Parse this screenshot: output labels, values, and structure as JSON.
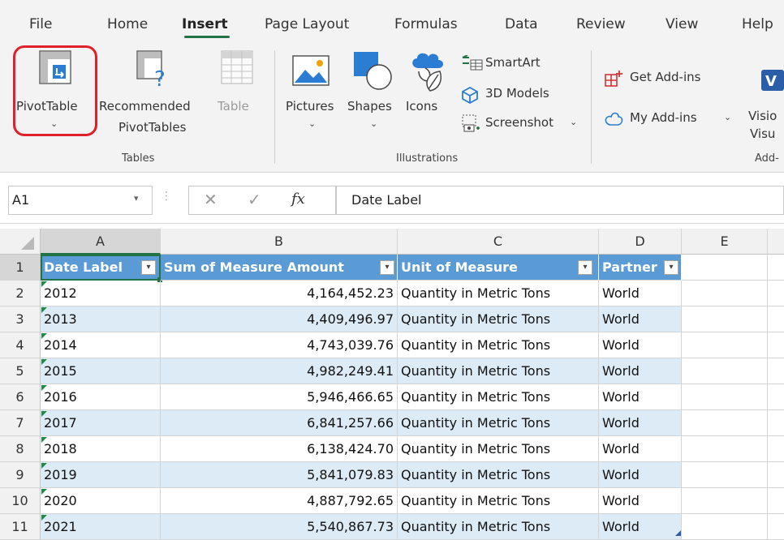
{
  "ribbon": {
    "tabs": [
      "File",
      "Home",
      "Insert",
      "Page Layout",
      "Formulas",
      "Data",
      "Review",
      "View",
      "Help"
    ],
    "active_tab": "Insert",
    "tables_group": {
      "label": "Tables",
      "pivottable": "PivotTable",
      "recommended_line1": "Recommended",
      "recommended_line2": "PivotTables",
      "table": "Table"
    },
    "illustrations_group": {
      "label": "Illustrations",
      "pictures": "Pictures",
      "shapes": "Shapes",
      "icons": "Icons",
      "smartart": "SmartArt",
      "models3d": "3D Models",
      "screenshot": "Screenshot"
    },
    "addins_group": {
      "label": "Add-",
      "get_addins": "Get Add-ins",
      "my_addins": "My Add-ins",
      "visio_line1": "Visio",
      "visio_line2": "Visu"
    },
    "colors": {
      "accent": "#217346",
      "highlight": "#e0202a"
    }
  },
  "formula_bar": {
    "name_box": "A1",
    "fx": "fx",
    "value": "Date Label"
  },
  "grid": {
    "columns": [
      "A",
      "B",
      "C",
      "D",
      "E"
    ],
    "headers": [
      "Date Label",
      "Sum of Measure Amount",
      "Unit of Measure",
      "Partner"
    ],
    "rows": [
      {
        "n": "2",
        "year": "2012",
        "amount": "4,164,452.23",
        "unit": "Quantity in Metric Tons",
        "partner": "World"
      },
      {
        "n": "3",
        "year": "2013",
        "amount": "4,409,496.97",
        "unit": "Quantity in Metric Tons",
        "partner": "World"
      },
      {
        "n": "4",
        "year": "2014",
        "amount": "4,743,039.76",
        "unit": "Quantity in Metric Tons",
        "partner": "World"
      },
      {
        "n": "5",
        "year": "2015",
        "amount": "4,982,249.41",
        "unit": "Quantity in Metric Tons",
        "partner": "World"
      },
      {
        "n": "6",
        "year": "2016",
        "amount": "5,946,466.65",
        "unit": "Quantity in Metric Tons",
        "partner": "World"
      },
      {
        "n": "7",
        "year": "2017",
        "amount": "6,841,257.66",
        "unit": "Quantity in Metric Tons",
        "partner": "World"
      },
      {
        "n": "8",
        "year": "2018",
        "amount": "6,138,424.70",
        "unit": "Quantity in Metric Tons",
        "partner": "World"
      },
      {
        "n": "9",
        "year": "2019",
        "amount": "5,841,079.83",
        "unit": "Quantity in Metric Tons",
        "partner": "World"
      },
      {
        "n": "10",
        "year": "2020",
        "amount": "4,887,792.65",
        "unit": "Quantity in Metric Tons",
        "partner": "World"
      },
      {
        "n": "11",
        "year": "2021",
        "amount": "5,540,867.73",
        "unit": "Quantity in Metric Tons",
        "partner": "World"
      }
    ],
    "header_row_number": "1",
    "colors": {
      "header_fill": "#5b9bd5",
      "band_fill": "#ddebf7"
    }
  }
}
